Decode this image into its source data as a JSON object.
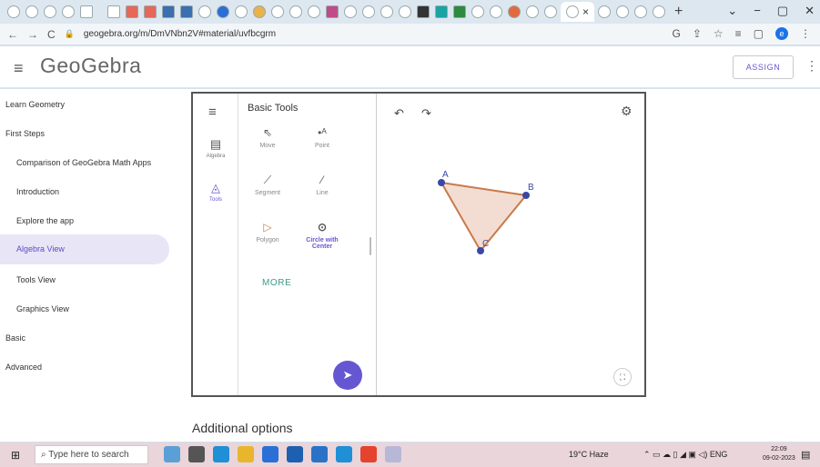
{
  "browser": {
    "active_tab_icon": "geogebra-icon",
    "tab_close": "×",
    "new_tab": "+",
    "window_controls": [
      "⌄",
      "−",
      "▢",
      "✕"
    ],
    "url": "geogebra.org/m/DmVNbn2V#material/uvfbcgrm",
    "nav": {
      "back": "←",
      "forward": "→",
      "reload": "C"
    },
    "profile_initial": "e"
  },
  "header": {
    "logo": "GeoGebra",
    "assign_label": "ASSIGN",
    "menu_icon": "hamburger-icon",
    "more_icon": "kebab-icon"
  },
  "sidebar": {
    "items": [
      {
        "label": "Learn Geometry"
      },
      {
        "label": "First Steps"
      },
      {
        "label": "Comparison of GeoGebra Math Apps"
      },
      {
        "label": "Introduction"
      },
      {
        "label": "Explore the app"
      },
      {
        "label": "Algebra View"
      },
      {
        "label": "Tools View"
      },
      {
        "label": "Graphics View"
      },
      {
        "label": "Basic"
      },
      {
        "label": "Advanced"
      }
    ],
    "active": "Algebra View"
  },
  "applet": {
    "rail": {
      "algebra_label": "Algebra",
      "tools_label": "Tools"
    },
    "tools_title": "Basic Tools",
    "tools": [
      {
        "label": "Move"
      },
      {
        "label": "Point"
      },
      {
        "label": "Segment"
      },
      {
        "label": "Line"
      },
      {
        "label": "Polygon"
      },
      {
        "label": "Circle with Center"
      }
    ],
    "selected_tool": "Circle with Center",
    "more_label": "MORE",
    "points": {
      "A": "A",
      "B": "B",
      "C": "C"
    },
    "fill_color": "#f3ddd2",
    "edge_color": "#c87a4a",
    "point_color": "#3b47a6"
  },
  "additional_options": "Additional options",
  "taskbar": {
    "search_placeholder": "Type here to search",
    "weather": "19°C Haze",
    "language": "ENG",
    "time": "22:09",
    "date": "09-02-2023"
  }
}
